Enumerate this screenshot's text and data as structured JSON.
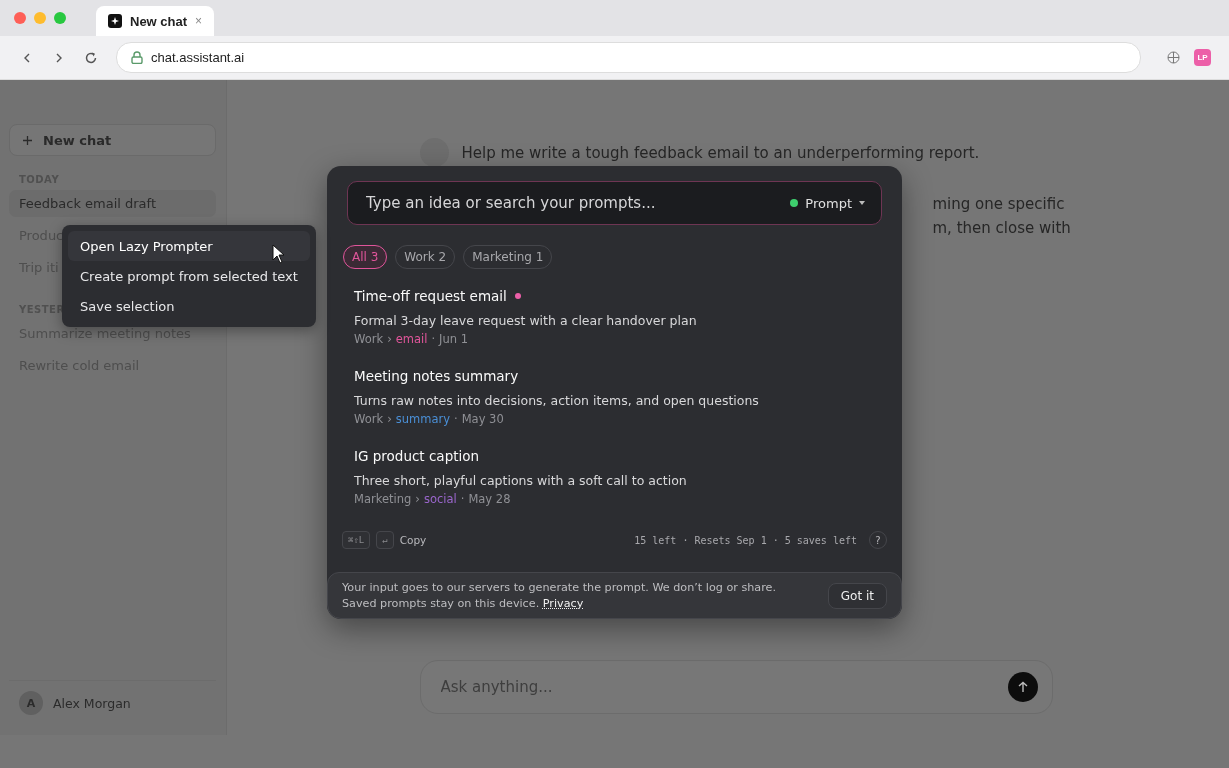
{
  "browser": {
    "tab": {
      "title": "New chat",
      "close": "×"
    },
    "url": "chat.assistant.ai",
    "extension_badge": "LP"
  },
  "sidebar": {
    "new_chat": "New chat",
    "sections": [
      {
        "heading": "TODAY",
        "items": [
          {
            "label": "Feedback email draft",
            "selected": true
          },
          {
            "label": "Produc",
            "selected": false
          },
          {
            "label": "Trip iti",
            "selected": false
          }
        ]
      },
      {
        "heading": "YESTER",
        "items": [
          {
            "label": "Summarize meeting notes",
            "selected": false
          },
          {
            "label": "Rewrite cold email",
            "selected": false
          }
        ]
      }
    ],
    "user": {
      "initial": "A",
      "name": "Alex Morgan"
    }
  },
  "chat": {
    "user_message": "Help me write a tough feedback email to an underperforming report.",
    "reply_lines": [
      "ming one specific",
      "m, then close with"
    ],
    "composer": {
      "placeholder": "Ask anything..."
    }
  },
  "context_menu": {
    "items": [
      {
        "label": "Open Lazy Prompter",
        "selected": true
      },
      {
        "label": "Create prompt from selected text",
        "selected": false
      },
      {
        "label": "Save selection",
        "selected": false
      }
    ]
  },
  "prompter": {
    "search": {
      "placeholder": "Type an idea or search your prompts..."
    },
    "mode": "Prompt",
    "filters": [
      {
        "label": "All 3",
        "selected": true
      },
      {
        "label": "Work 2",
        "selected": false
      },
      {
        "label": "Marketing 1",
        "selected": false
      }
    ],
    "prompts": [
      {
        "title": "Time-off request email",
        "unread": true,
        "description": "Formal 3-day leave request with a clear handover plan",
        "folder": "Work",
        "tag": "email",
        "color": "#e0559a",
        "date": "Jun 1"
      },
      {
        "title": "Meeting notes summary",
        "unread": false,
        "description": "Turns raw notes into decisions, action items, and open questions",
        "folder": "Work",
        "tag": "summary",
        "color": "#4a8fd6",
        "date": "May 30"
      },
      {
        "title": "IG product caption",
        "unread": false,
        "description": "Three short, playful captions with a soft call to action",
        "folder": "Marketing",
        "tag": "social",
        "color": "#9a66cc",
        "date": "May 28"
      }
    ],
    "separator": "›",
    "dot": "·",
    "footer": {
      "shortcut": "⌘⇧L",
      "enter_key": "↵",
      "copy": "Copy",
      "quota": "15 left · Resets Sep 1 · 5 saves left",
      "help": "?"
    },
    "notice": {
      "text": "Your input goes to our servers to generate the prompt. We don’t log or share. Saved prompts stay on this device.",
      "link": "Privacy",
      "button": "Got it"
    }
  }
}
